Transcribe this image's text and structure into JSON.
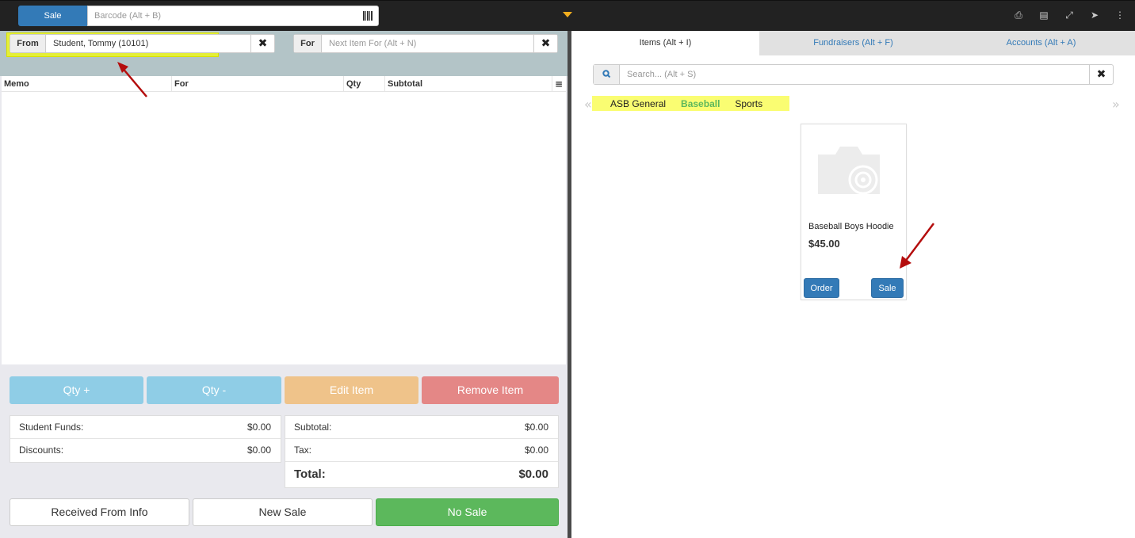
{
  "topbar": {
    "mode_label": "Sale",
    "barcode_placeholder": "Barcode (Alt + B)"
  },
  "left": {
    "from_label": "From",
    "from_value": "Student, Tommy (10101)",
    "for_label": "For",
    "for_placeholder": "Next Item For (Alt + N)",
    "columns": [
      "Memo",
      "For",
      "Qty",
      "Subtotal"
    ],
    "actions": {
      "qty_plus": "Qty +",
      "qty_minus": "Qty -",
      "edit": "Edit Item",
      "remove": "Remove Item"
    },
    "funds": {
      "student_funds_label": "Student Funds:",
      "student_funds_value": "$0.00",
      "discounts_label": "Discounts:",
      "discounts_value": "$0.00"
    },
    "totals": {
      "subtotal_label": "Subtotal:",
      "subtotal_value": "$0.00",
      "tax_label": "Tax:",
      "tax_value": "$0.00",
      "total_label": "Total:",
      "total_value": "$0.00"
    },
    "bottom": {
      "received_from": "Received From Info",
      "new_sale": "New Sale",
      "no_sale": "No Sale"
    }
  },
  "right": {
    "tabs": [
      "Items (Alt + I)",
      "Fundraisers (Alt + F)",
      "Accounts (Alt + A)"
    ],
    "search_placeholder": "Search... (Alt + S)",
    "categories": [
      "ASB General",
      "Baseball",
      "Sports"
    ],
    "active_category": "Baseball",
    "item": {
      "name": "Baseball Boys Hoodie",
      "price": "$45.00",
      "order_label": "Order",
      "sale_label": "Sale"
    }
  },
  "icons": {
    "top_right": [
      "print-icon",
      "receipt-icon",
      "fullscreen-icon",
      "circle-arrow-icon",
      "more-vertical-icon"
    ]
  },
  "colors": {
    "primary": "#337ab7",
    "success": "#5cb85c",
    "highlight": "#f6ff00",
    "annotation_arrow": "#b40d0d"
  }
}
